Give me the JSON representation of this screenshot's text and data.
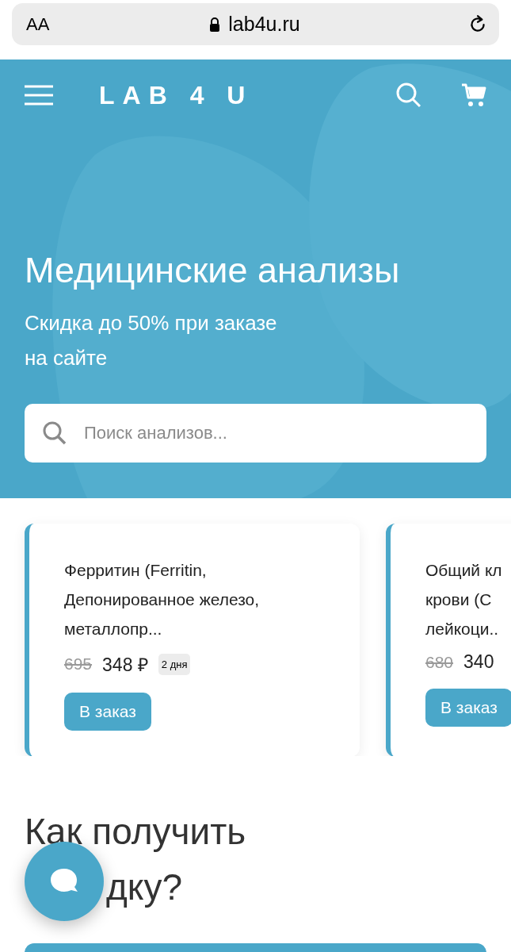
{
  "browser": {
    "text_size_button": "AA",
    "url": "lab4u.ru"
  },
  "header": {
    "logo": "LAB 4 U"
  },
  "hero": {
    "title": "Медицинские анализы",
    "subtitle": "Скидка до 50% при заказе на сайте",
    "search": {
      "placeholder": "Поиск анализов..."
    }
  },
  "products": [
    {
      "name_lines": [
        "Ферритин (Ferritin,",
        "Депонированное железо,",
        "металлопр..."
      ],
      "old_price": "695",
      "price": "348 ₽",
      "badge": "2 дня",
      "button": "В заказ"
    },
    {
      "name_lines": [
        "Общий кл",
        "крови (С",
        "лейкоци.."
      ],
      "old_price": "680",
      "price": "340",
      "button": "В заказ"
    }
  ],
  "section": {
    "heading_lines": [
      "Как получить",
      "дку?"
    ]
  }
}
